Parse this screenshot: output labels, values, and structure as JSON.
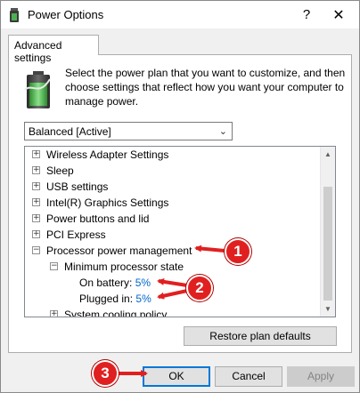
{
  "window": {
    "title": "Power Options",
    "help_glyph": "?",
    "close_glyph": "✕"
  },
  "tab": {
    "label": "Advanced settings"
  },
  "description": "Select the power plan that you want to customize, and then choose settings that reflect how you want your computer to manage power.",
  "plan_select": {
    "value": "Balanced [Active]",
    "chevron": "⌄"
  },
  "tree": {
    "items": [
      {
        "label": "Wireless Adapter Settings",
        "expander": "+"
      },
      {
        "label": "Sleep",
        "expander": "+"
      },
      {
        "label": "USB settings",
        "expander": "+"
      },
      {
        "label": "Intel(R) Graphics Settings",
        "expander": "+"
      },
      {
        "label": "Power buttons and lid",
        "expander": "+"
      },
      {
        "label": "PCI Express",
        "expander": "+"
      },
      {
        "label": "Processor power management",
        "expander": "−"
      },
      {
        "label": "Minimum processor state",
        "expander": "−"
      },
      {
        "label": "On battery:",
        "value": "5%"
      },
      {
        "label": "Plugged in:",
        "value": "5%"
      },
      {
        "label": "System cooling policy",
        "expander": "+"
      }
    ]
  },
  "buttons": {
    "restore": "Restore plan defaults",
    "ok": "OK",
    "cancel": "Cancel",
    "apply": "Apply"
  },
  "annotations": {
    "markers": [
      "1",
      "2",
      "3"
    ],
    "color": "#e02020"
  },
  "colors": {
    "link": "#0066cc",
    "focus_border": "#0078d7"
  }
}
